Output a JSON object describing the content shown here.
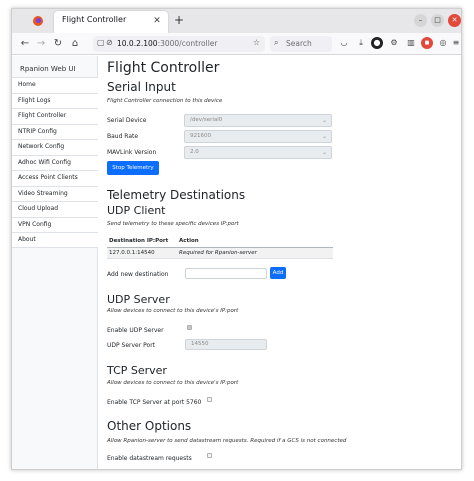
{
  "browser": {
    "tab_title": "Flight Controller",
    "tab_close": "✕",
    "new_tab": "+",
    "url_host": "10.0.2.100",
    "url_path": ":3000/controller",
    "search_placeholder": "Search",
    "colors": {
      "favicon": "#e8581c",
      "win_close": "#e3493b",
      "accent": "#0d6efd"
    }
  },
  "sidebar": {
    "brand": "Rpanion Web UI",
    "items": [
      {
        "label": "Home"
      },
      {
        "label": "Flight Logs"
      },
      {
        "label": "Flight Controller"
      },
      {
        "label": "NTRIP Config"
      },
      {
        "label": "Network Config"
      },
      {
        "label": "Adhoc Wifi Config"
      },
      {
        "label": "Access Point Clients"
      },
      {
        "label": "Video Streaming"
      },
      {
        "label": "Cloud Upload"
      },
      {
        "label": "VPN Config"
      },
      {
        "label": "About"
      }
    ]
  },
  "main": {
    "title": "Flight Controller",
    "serial": {
      "heading": "Serial Input",
      "desc": "Flight Controller connection to this device",
      "device_label": "Serial Device",
      "device_value": "/dev/serial0",
      "baud_label": "Baud Rate",
      "baud_value": "921600",
      "mavlink_label": "MAVLink Version",
      "mavlink_value": "2.0",
      "stop_button": "Stop Telemetry"
    },
    "telemetry": {
      "heading": "Telemetry Destinations",
      "udp_client": {
        "heading": "UDP Client",
        "desc": "Send telemetry to these specific devices IP:port",
        "columns": [
          "Destination IP:Port",
          "Action"
        ],
        "rows": [
          [
            "127.0.0.1:14540",
            "Required for Rpanion-server"
          ]
        ],
        "add_label": "Add new destination",
        "add_button": "Add"
      },
      "udp_server": {
        "heading": "UDP Server",
        "desc": "Allow devices to connect to this device's IP:port",
        "enable_label": "Enable UDP Server",
        "enable_checked": true,
        "port_label": "UDP Server Port",
        "port_value": "14550"
      },
      "tcp_server": {
        "heading": "TCP Server",
        "desc": "Allow devices to connect to this device's IP:port",
        "enable_label": "Enable TCP Server at port 5760",
        "enable_checked": false
      }
    },
    "other": {
      "heading": "Other Options",
      "desc": "Allow Rpanion-server to send datastream requests. Required if a GCS is not connected",
      "datastream_label": "Enable datastream requests",
      "datastream_checked": false
    }
  }
}
